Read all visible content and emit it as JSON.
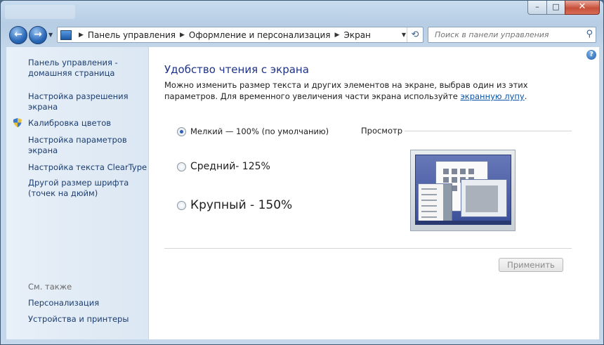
{
  "window": {
    "min_label": "–",
    "max_label": "□",
    "close_label": "✕"
  },
  "nav": {
    "back_label": "←",
    "forward_label": "→",
    "breadcrumb": [
      "Панель управления",
      "Оформление и персонализация",
      "Экран"
    ],
    "search_placeholder": "Поиск в панели управления"
  },
  "sidebar": {
    "items": [
      "Панель управления -\nдомашняя страница",
      "Настройка разрешения\nэкрана",
      "Калибровка цветов",
      "Настройка параметров\nэкрана",
      "Настройка текста ClearType",
      "Другой размер шрифта\n(точек на дюйм)"
    ],
    "see_also_label": "См. также",
    "see_also": [
      "Персонализация",
      "Устройства и принтеры"
    ]
  },
  "main": {
    "heading": "Удобство чтения с экрана",
    "description_before": "Можно изменить размер текста и других элементов на экране, выбрав один из этих параметров. Для временного увеличения части экрана используйте ",
    "description_link": "экранную лупу",
    "description_after": ".",
    "options": [
      {
        "label": "Мелкий — 100% (по умолчанию)",
        "selected": true
      },
      {
        "label": "Средний- 125%",
        "selected": false
      },
      {
        "label": "Крупный - 150%",
        "selected": false
      }
    ],
    "preview_label": "Просмотр",
    "apply_label": "Применить",
    "help_label": "?"
  }
}
